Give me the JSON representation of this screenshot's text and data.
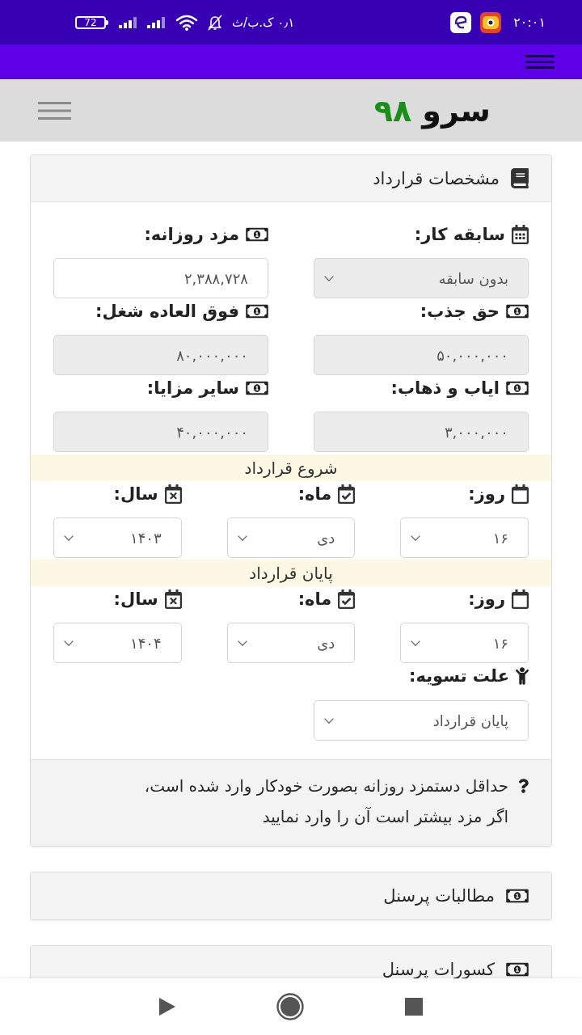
{
  "status_bar": {
    "network_speed": "۰٫۱ ک.ب/ث",
    "battery": "72",
    "time": "۲۰:۰۱"
  },
  "header": {
    "logo_word": "سرو",
    "logo_number": "۹۸"
  },
  "contract_card": {
    "title": "مشخصات قرارداد",
    "fields": [
      {
        "kind": "select",
        "label": "سابقه کار:",
        "value": "بدون سابقه",
        "disabled": true
      },
      {
        "kind": "input",
        "label": "مزد روزانه:",
        "value": "۲,۳۸۸,۷۲۸",
        "disabled": false
      },
      {
        "kind": "input",
        "label": "حق جذب:",
        "value": "۵۰,۰۰۰,۰۰۰",
        "disabled": true
      },
      {
        "kind": "input",
        "label": "فوق العاده شغل:",
        "value": "۸۰,۰۰۰,۰۰۰",
        "disabled": true
      },
      {
        "kind": "input",
        "label": "ایاب و ذهاب:",
        "value": "۳,۰۰۰,۰۰۰",
        "disabled": true
      },
      {
        "kind": "input",
        "label": "سایر مزایا:",
        "value": "۴۰,۰۰۰,۰۰۰",
        "disabled": true
      }
    ],
    "periods": [
      {
        "title": "شروع قرارداد",
        "day": {
          "label": "روز:",
          "value": "۱۶"
        },
        "month": {
          "label": "ماه:",
          "value": "دی"
        },
        "year": {
          "label": "سال:",
          "value": "۱۴۰۳"
        }
      },
      {
        "title": "پایان قرارداد",
        "day": {
          "label": "روز:",
          "value": "۱۶"
        },
        "month": {
          "label": "ماه:",
          "value": "دی"
        },
        "year": {
          "label": "سال:",
          "value": "۱۴۰۴"
        }
      }
    ],
    "settlement": {
      "label": "علت تسویه:",
      "value": "پایان قرارداد"
    },
    "note": "حداقل دستمزد روزانه بصورت خودکار وارد شده است، اگر مزد بیشتر است آن را وارد نمایید"
  },
  "collapsed_cards": [
    {
      "title": "مطالبات پرسنل"
    },
    {
      "title": "کسورات پرسنل"
    }
  ]
}
